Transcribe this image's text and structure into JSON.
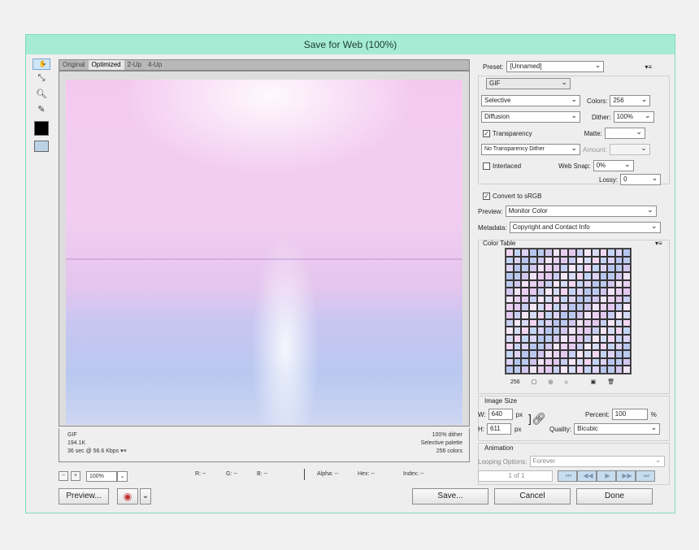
{
  "window": {
    "title": "Save for Web (100%)"
  },
  "tabs": [
    {
      "label": "Original"
    },
    {
      "label": "Optimized"
    },
    {
      "label": "2-Up"
    },
    {
      "label": "4-Up"
    }
  ],
  "image_info": {
    "format": "GIF",
    "size": "194.1K",
    "time": "36 sec @ 56.6 Kbps",
    "dither": "100% dither",
    "palette": "Selective palette",
    "colors": "256 colors"
  },
  "status": {
    "zoom": "100%",
    "r": "R: --",
    "g": "G: --",
    "b": "B: --",
    "alpha": "Alpha: --",
    "hex": "Hex: --",
    "index": "Index: --"
  },
  "buttons": {
    "preview": "Preview...",
    "save": "Save...",
    "cancel": "Cancel",
    "done": "Done"
  },
  "settings": {
    "preset_label": "Preset:",
    "preset_value": "[Unnamed]",
    "format": "GIF",
    "reduction": "Selective",
    "colors_label": "Colors:",
    "colors_value": "256",
    "dither_algo": "Diffusion",
    "dither_label": "Dither:",
    "dither_value": "100%",
    "transparency_label": "Transparency",
    "matte_label": "Matte:",
    "trans_dither": "No Transparency Dither",
    "amount_label": "Amount:",
    "interlaced_label": "Interlaced",
    "websnap_label": "Web Snap:",
    "websnap_value": "0%",
    "lossy_label": "Lossy:",
    "lossy_value": "0",
    "srgb_label": "Convert to sRGB",
    "preview_label": "Preview:",
    "preview_value": "Monitor Color",
    "metadata_label": "Metadata:",
    "metadata_value": "Copyright and Contact Info"
  },
  "color_table": {
    "title": "Color Table",
    "count": "256"
  },
  "image_size": {
    "title": "Image Size",
    "w_label": "W:",
    "w_value": "640",
    "h_label": "H:",
    "h_value": "611",
    "unit": "px",
    "percent_label": "Percent:",
    "percent_value": "100",
    "percent_unit": "%",
    "quality_label": "Quality:",
    "quality_value": "Bicubic"
  },
  "animation": {
    "title": "Animation",
    "looping_label": "Looping Options:",
    "looping_value": "Forever",
    "frame": "1 of 1"
  },
  "colors": {
    "title_bar": "#a6ecd5",
    "accent": "#7fd9c0"
  }
}
